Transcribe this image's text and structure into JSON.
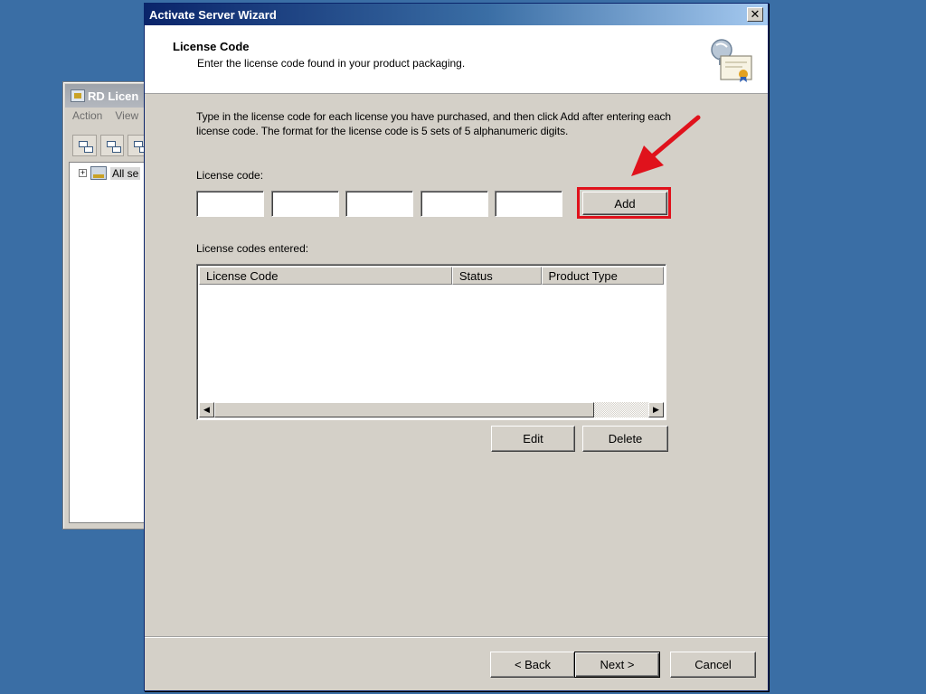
{
  "background_window": {
    "title": "RD Licen",
    "menu": [
      "Action",
      "View"
    ],
    "tree_item": "All se"
  },
  "wizard": {
    "title": "Activate Server Wizard",
    "close_glyph": "✕",
    "header": {
      "title": "License Code",
      "subtitle": "Enter the license code found in your product packaging."
    },
    "instructions": "Type in the license code for each license you have purchased, and then click Add after entering each license code. The format for the license code is 5 sets of 5 alphanumeric digits.",
    "license_code_label": "License code:",
    "code_fields": [
      "",
      "",
      "",
      "",
      ""
    ],
    "add_label": "Add",
    "entered_label": "License codes entered:",
    "list_columns": [
      "License Code",
      "Status",
      "Product Type"
    ],
    "edit_label": "Edit",
    "delete_label": "Delete",
    "back_label": "< Back",
    "next_label": "Next >",
    "cancel_label": "Cancel"
  },
  "colors": {
    "desktop": "#3a6ea5",
    "highlight": "#e0121c",
    "arrow": "#e0121c"
  }
}
